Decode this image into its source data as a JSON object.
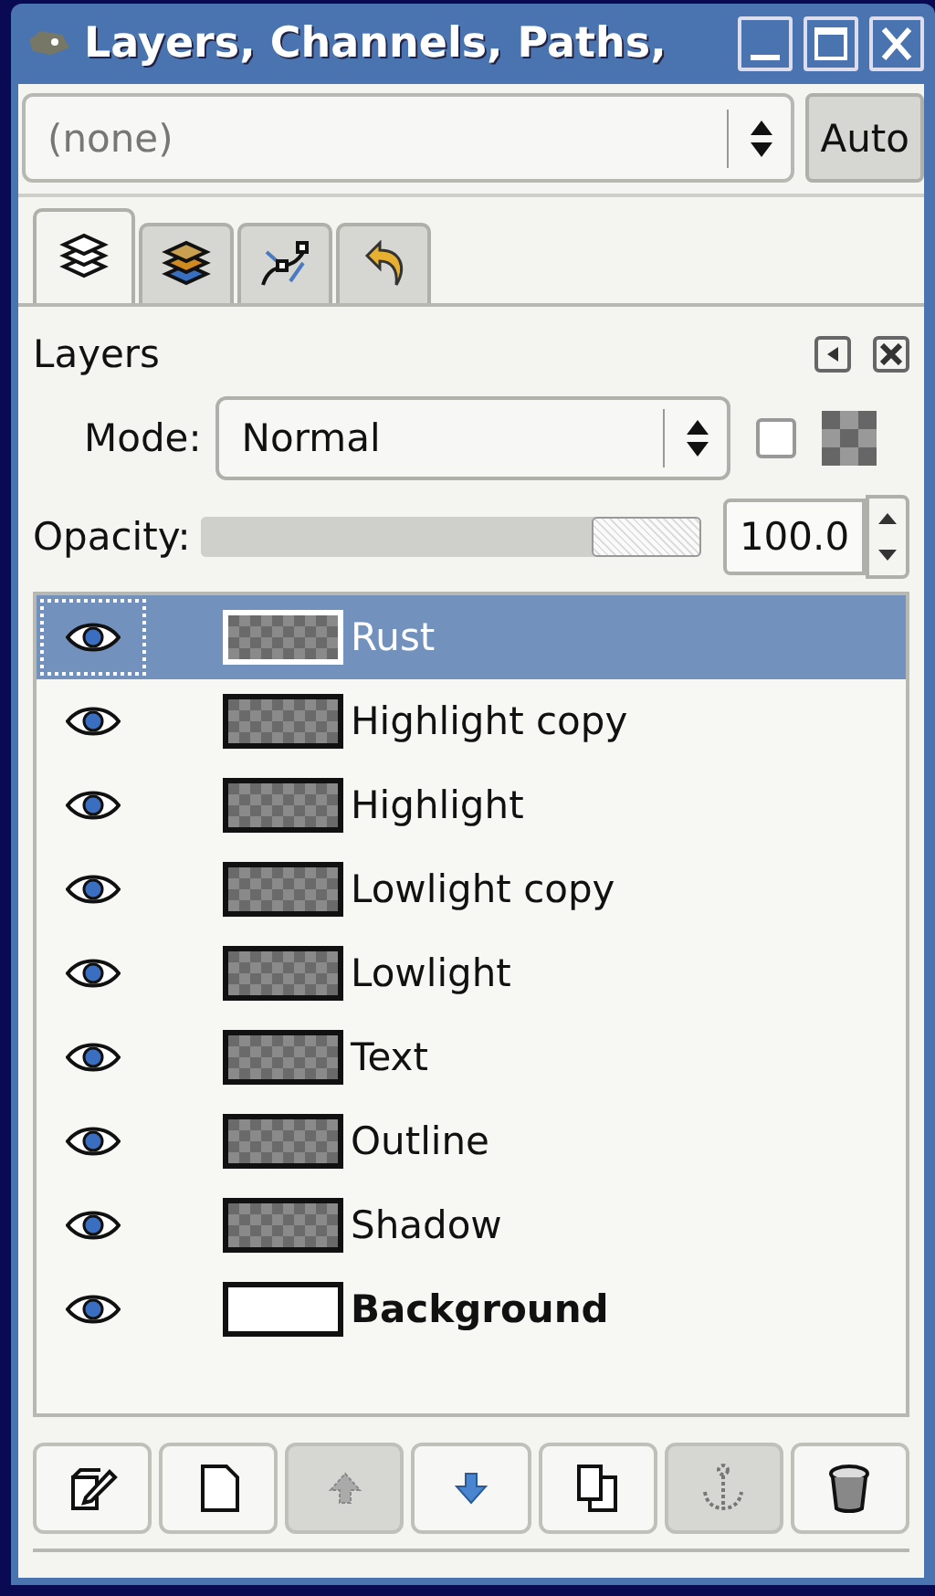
{
  "window": {
    "title": "Layers, Channels, Paths,"
  },
  "image_menu": {
    "value": "(none)",
    "auto_button": "Auto"
  },
  "tabs": [
    {
      "kind": "layers",
      "selected": true
    },
    {
      "kind": "channels",
      "selected": false
    },
    {
      "kind": "paths",
      "selected": false
    },
    {
      "kind": "undo",
      "selected": false
    }
  ],
  "panel": {
    "title": "Layers",
    "mode_label": "Mode:",
    "mode_value": "Normal",
    "lock_alpha": {
      "checked": false
    },
    "opacity_label": "Opacity:",
    "opacity": {
      "level": 1,
      "value": "100.0"
    }
  },
  "layers": [
    {
      "name": "Rust",
      "kind": "layer",
      "visible": true,
      "selected": true
    },
    {
      "name": "Highlight copy",
      "kind": "layer",
      "visible": true,
      "selected": false
    },
    {
      "name": "Highlight",
      "kind": "layer",
      "visible": true,
      "selected": false
    },
    {
      "name": "Lowlight copy",
      "kind": "layer",
      "visible": true,
      "selected": false
    },
    {
      "name": "Lowlight",
      "kind": "layer",
      "visible": true,
      "selected": false
    },
    {
      "name": "Text",
      "kind": "layer",
      "visible": true,
      "selected": false
    },
    {
      "name": "Outline",
      "kind": "layer",
      "visible": true,
      "selected": false
    },
    {
      "name": "Shadow",
      "kind": "layer",
      "visible": true,
      "selected": false
    },
    {
      "name": "Background",
      "kind": "background",
      "visible": true,
      "selected": false
    }
  ],
  "buttons": [
    {
      "kind": "edit",
      "disabled": false
    },
    {
      "kind": "new",
      "disabled": false
    },
    {
      "kind": "raise",
      "disabled": true
    },
    {
      "kind": "lower",
      "disabled": false
    },
    {
      "kind": "duplicate",
      "disabled": false
    },
    {
      "kind": "anchor",
      "disabled": true
    },
    {
      "kind": "delete",
      "disabled": false
    }
  ]
}
